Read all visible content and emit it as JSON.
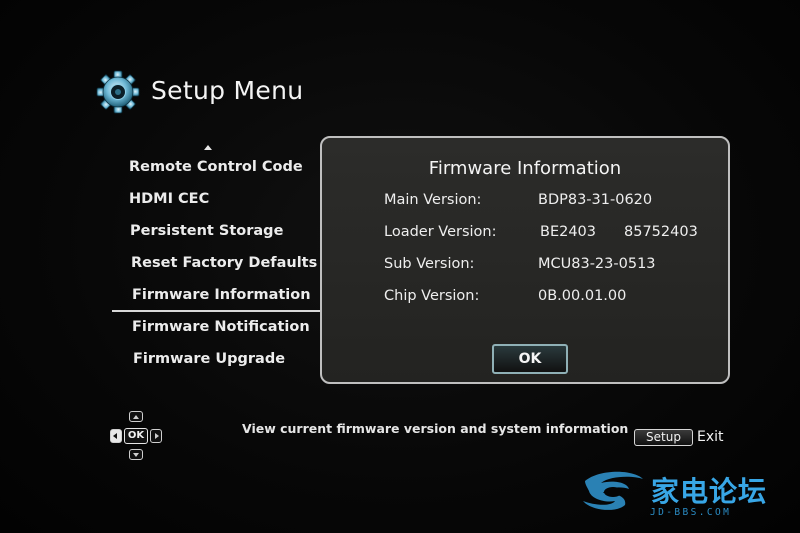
{
  "header": {
    "title": "Setup Menu",
    "icon": "gear-icon"
  },
  "menu": {
    "items": [
      {
        "label": "Remote Control Code"
      },
      {
        "label": "HDMI CEC"
      },
      {
        "label": "Persistent Storage"
      },
      {
        "label": "Reset Factory Defaults"
      },
      {
        "label": "Firmware Information",
        "selected": true
      },
      {
        "label": "Firmware Notification"
      },
      {
        "label": "Firmware Upgrade"
      }
    ]
  },
  "dialog": {
    "title": "Firmware Information",
    "rows": [
      {
        "label": "Main Version:",
        "value": "BDP83-31-0620"
      },
      {
        "label": "Loader Version:",
        "value": "BE2403",
        "value2": "85752403"
      },
      {
        "label": "Sub Version:",
        "value": "MCU83-23-0513"
      },
      {
        "label": "Chip Version:",
        "value": "0B.00.01.00"
      }
    ],
    "ok_label": "OK"
  },
  "footer": {
    "dpad_ok": "OK",
    "hint": "View current firmware version and  system information",
    "setup_label": "Setup",
    "exit_label": "Exit"
  },
  "watermark": {
    "text": "家电论坛",
    "sub": "JD-BBS.COM",
    "color": "#38a6e6"
  },
  "colors": {
    "background": "#050505",
    "dialog_bg": "#2a2a28",
    "dialog_border": "#bfbfbf",
    "ok_border": "#8fb0b6",
    "text": "#eeeeee"
  }
}
